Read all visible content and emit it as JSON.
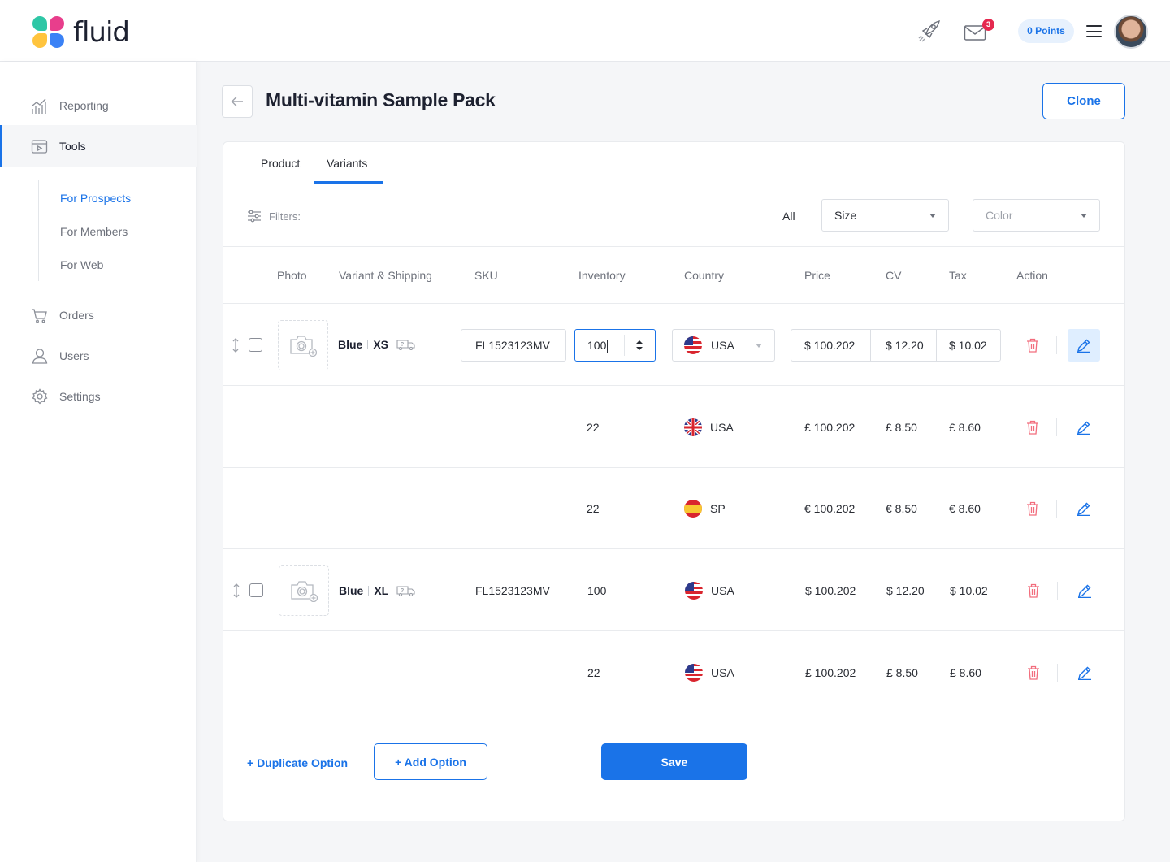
{
  "app": {
    "name": "fluid"
  },
  "topbar": {
    "mail_count": "3",
    "points": "0 Points"
  },
  "sidebar": {
    "items": [
      {
        "label": "Reporting"
      },
      {
        "label": "Tools"
      },
      {
        "label": "Orders"
      },
      {
        "label": "Users"
      },
      {
        "label": "Settings"
      }
    ],
    "subitems": [
      {
        "label": "For Prospects"
      },
      {
        "label": "For Members"
      },
      {
        "label": "For Web"
      }
    ]
  },
  "page": {
    "title": "Multi-vitamin Sample Pack",
    "clone_label": "Clone"
  },
  "tabs": [
    {
      "label": "Product"
    },
    {
      "label": "Variants"
    }
  ],
  "filters": {
    "label": "Filters:",
    "all_label": "All",
    "size_value": "Size",
    "color_placeholder": "Color"
  },
  "table": {
    "headers": [
      "Photo",
      "Variant & Shipping",
      "SKU",
      "Inventory",
      "Country",
      "Price",
      "CV",
      "Tax",
      "Action"
    ],
    "rows": [
      {
        "color": "Blue",
        "size": "XS",
        "sku": "FL1523123MV",
        "inventory": "100",
        "country": "USA",
        "flag": "us",
        "price": "$ 100.202",
        "cv": "$ 12.20",
        "tax": "$ 10.02",
        "editing": true
      },
      {
        "inventory": "22",
        "country": "USA",
        "flag": "uk",
        "price": "£ 100.202",
        "cv": "£ 8.50",
        "tax": "£ 8.60"
      },
      {
        "inventory": "22",
        "country": "SP",
        "flag": "es",
        "price": "€ 100.202",
        "cv": "€ 8.50",
        "tax": "€ 8.60"
      },
      {
        "color": "Blue",
        "size": "XL",
        "sku": "FL1523123MV",
        "inventory": "100",
        "country": "USA",
        "flag": "us",
        "price": "$ 100.202",
        "cv": "$ 12.20",
        "tax": "$ 10.02"
      },
      {
        "inventory": "22",
        "country": "USA",
        "flag": "us",
        "price": "£ 100.202",
        "cv": "£ 8.50",
        "tax": "£ 8.60"
      }
    ]
  },
  "footer": {
    "duplicate_label": "+ Duplicate Option",
    "add_label": "+ Add Option",
    "save_label": "Save"
  },
  "colors": {
    "accent": "#1a73e8",
    "danger": "#f26d7d",
    "badge": "#e5294f"
  }
}
